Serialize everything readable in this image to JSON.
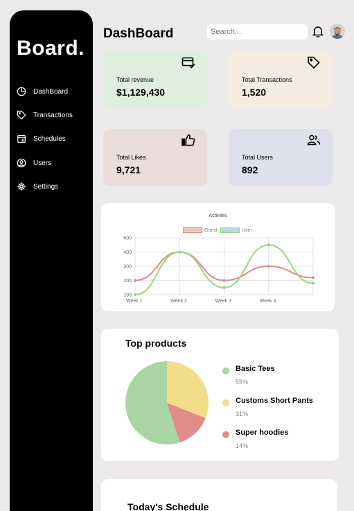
{
  "sidebar": {
    "brand": "Board.",
    "items": [
      {
        "label": "DashBoard",
        "icon": "pie-icon"
      },
      {
        "label": "Transactions",
        "icon": "tag-icon"
      },
      {
        "label": "Schedules",
        "icon": "calendar-icon"
      },
      {
        "label": "Users",
        "icon": "user-circle-icon"
      },
      {
        "label": "Settings",
        "icon": "gear-icon"
      }
    ]
  },
  "header": {
    "title": "DashBoard",
    "search_placeholder": "Search..."
  },
  "stats": [
    {
      "label": "Total revenue",
      "value": "$1,129,430",
      "icon": "card-check-icon",
      "color": "#deeedf"
    },
    {
      "label": "Total Transactions",
      "value": "1,520",
      "icon": "tag-icon",
      "color": "#f4ece0"
    },
    {
      "label": "Total Likes",
      "value": "9,721",
      "icon": "thumbs-up-icon",
      "color": "#ecdcdc"
    },
    {
      "label": "Total Users",
      "value": "892",
      "icon": "users-icon",
      "color": "#dfe0ee"
    }
  ],
  "chart_data": {
    "type": "line",
    "title": "Activites",
    "categories": [
      "Week 1",
      "Week 2",
      "Week 3",
      "Week 4"
    ],
    "ylim": [
      100,
      500
    ],
    "yticks": [
      "500",
      "400",
      "300",
      "200",
      "100"
    ],
    "grid": true,
    "legend_position": "top",
    "series": [
      {
        "name": "Guest",
        "color": "#e0888d",
        "values": [
          200,
          400,
          200,
          300,
          220
        ]
      },
      {
        "name": "User",
        "color": "#9ad47e",
        "values": [
          100,
          400,
          150,
          450,
          180
        ]
      }
    ]
  },
  "top_products": {
    "title": "Top products",
    "items": [
      {
        "name": "Basic Tees",
        "percent": "55%",
        "value": 55,
        "color": "#a8d5a3"
      },
      {
        "name": "Customs Short Pants",
        "percent": "31%",
        "value": 31,
        "color": "#f2dd8b"
      },
      {
        "name": "Super hoodies",
        "percent": "14%",
        "value": 14,
        "color": "#e08c88"
      }
    ]
  },
  "schedule": {
    "title": "Today's Schedule"
  }
}
